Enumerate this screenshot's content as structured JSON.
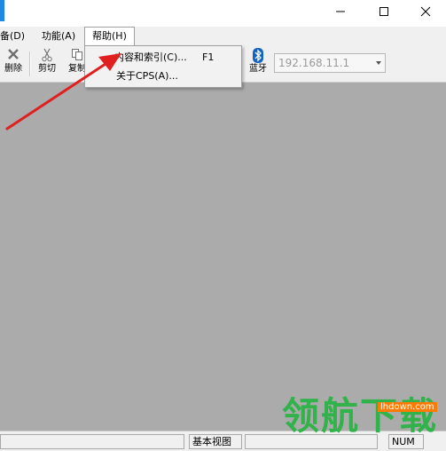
{
  "window": {
    "minimize_symbol": "—",
    "maximize_symbol": "☐",
    "close_symbol": "✕"
  },
  "menubar": {
    "items": [
      {
        "label": "备(D)"
      },
      {
        "label": "功能(A)"
      },
      {
        "label": "帮助(H)"
      }
    ]
  },
  "toolbar": {
    "delete_label": "删除",
    "cut_label": "剪切",
    "copy_label": "复制",
    "bluetooth_label": "蓝牙",
    "ip_value": "192.168.11.1"
  },
  "help_menu": {
    "items": [
      {
        "label": "内容和索引(C)...",
        "shortcut": "F1"
      },
      {
        "label": "关于CPS(A)...",
        "shortcut": ""
      }
    ]
  },
  "statusbar": {
    "view_label": "基本视图",
    "num_label": "NUM"
  },
  "watermark": {
    "brand": "领航下载",
    "url": "lhdown.com"
  },
  "colors": {
    "workspace": "#ababab",
    "arrow": "#e02020",
    "accent": "#1e88e5",
    "bluetooth": "#1565c0"
  }
}
